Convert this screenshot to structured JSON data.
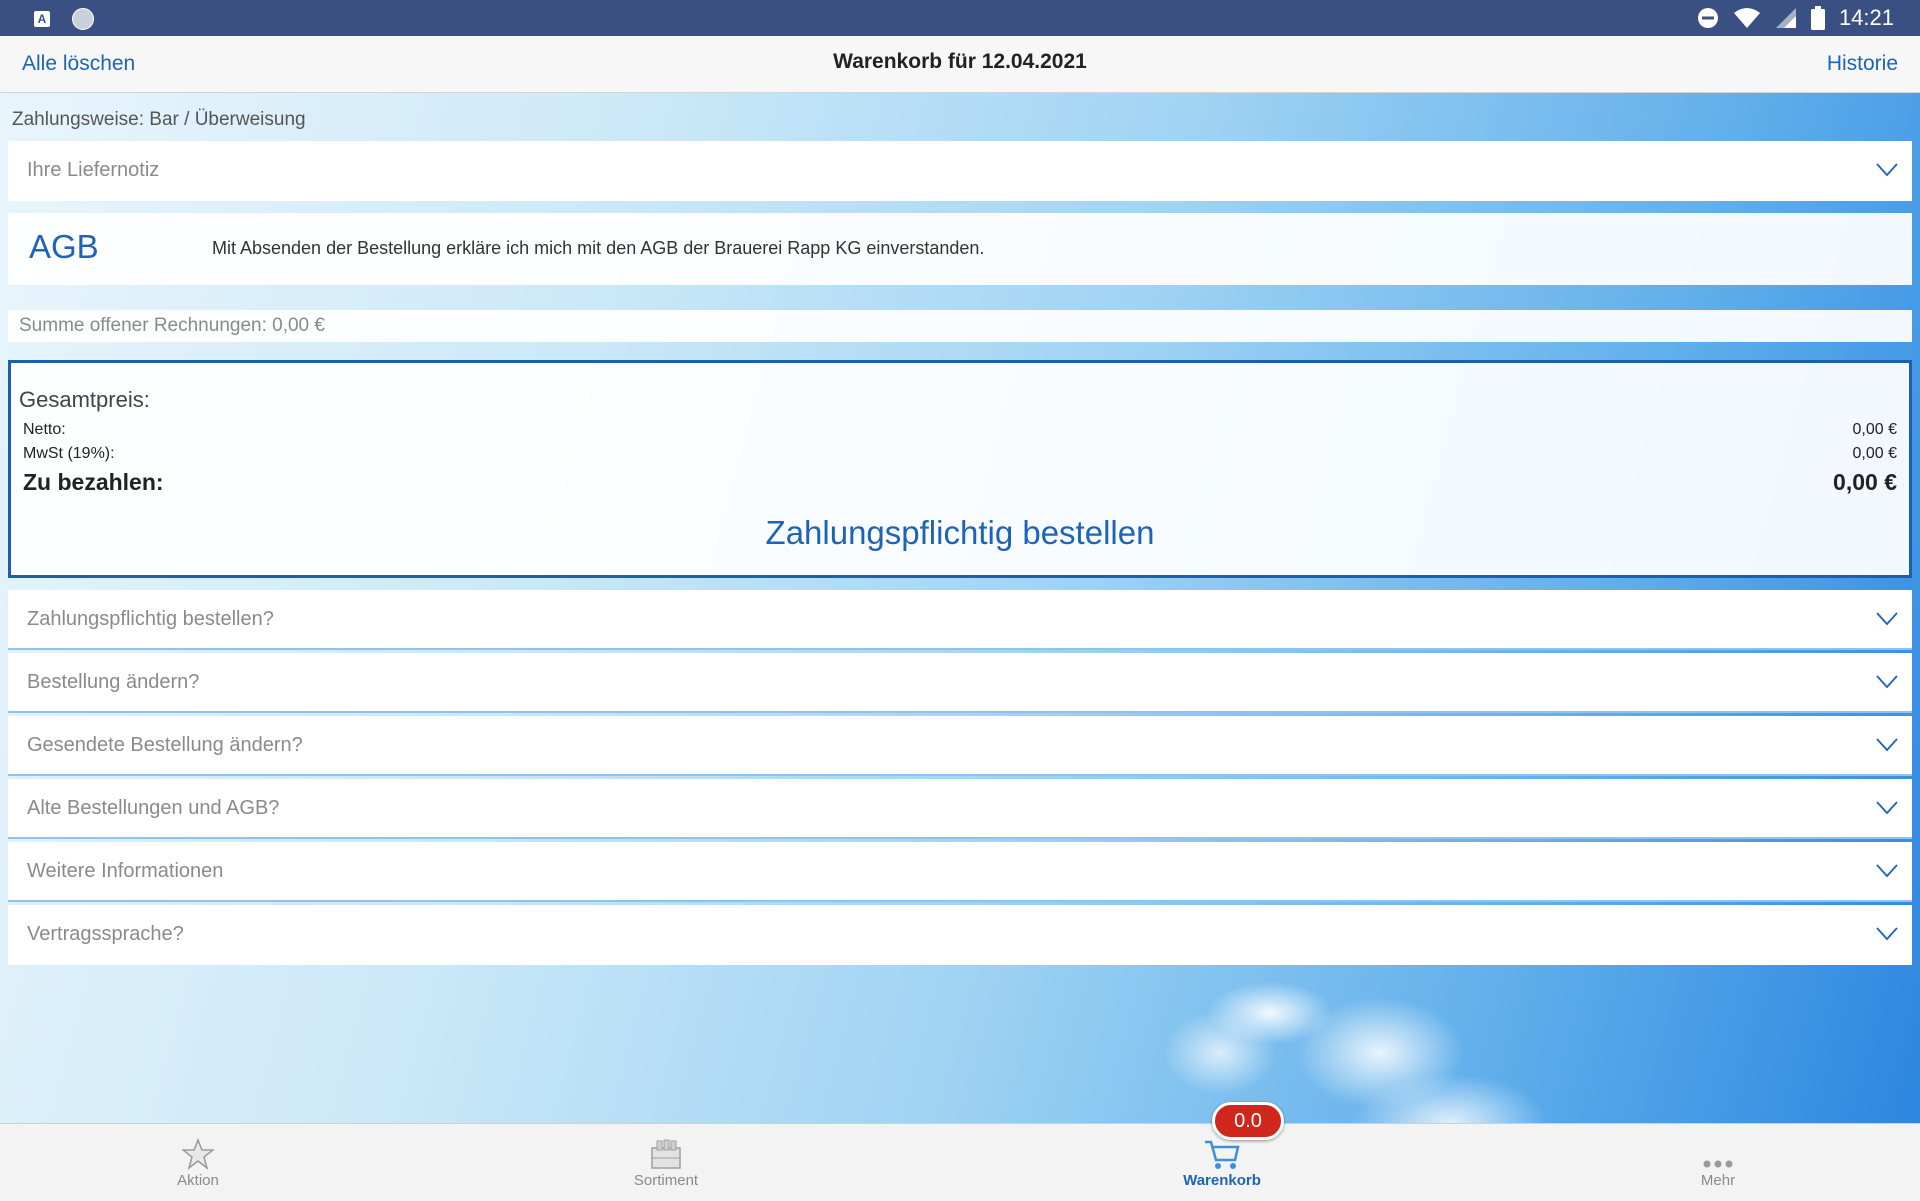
{
  "statusbar": {
    "time": "14:21",
    "left_icons": [
      "app-a-icon",
      "circle-icon"
    ],
    "right_icons": [
      "dnd-icon",
      "wifi-icon",
      "signal-icon",
      "battery-icon"
    ]
  },
  "navbar": {
    "left_label": "Alle löschen",
    "title": "Warenkorb für 12.04.2021",
    "right_label": "Historie"
  },
  "payment": {
    "text": "Zahlungsweise: Bar / Überweisung"
  },
  "delivery_note": {
    "label": "Ihre Liefernotiz"
  },
  "agb": {
    "title": "AGB",
    "text": "Mit Absenden der Bestellung erkläre ich mich mit den AGB der Brauerei Rapp KG einverstanden."
  },
  "invoices": {
    "text": "Summe offener Rechnungen: 0,00 €"
  },
  "totals": {
    "title": "Gesamtpreis:",
    "netto_label": "Netto:",
    "netto_value": "0,00 €",
    "vat_label": "MwSt (19%):",
    "vat_value": "0,00 €",
    "pay_label": "Zu bezahlen:",
    "pay_value": "0,00 €",
    "order_button": "Zahlungspflichtig bestellen"
  },
  "faq": [
    {
      "label": "Zahlungspflichtig bestellen?"
    },
    {
      "label": "Bestellung ändern?"
    },
    {
      "label": "Gesendete Bestellung ändern?"
    },
    {
      "label": "Alte Bestellungen und AGB?"
    },
    {
      "label": "Weitere Informationen"
    },
    {
      "label": "Vertragssprache?"
    }
  ],
  "tabs": [
    {
      "label": "Aktion",
      "icon": "star-icon",
      "active": false
    },
    {
      "label": "Sortiment",
      "icon": "crate-icon",
      "active": false
    },
    {
      "label": "Warenkorb",
      "icon": "cart-icon",
      "active": true
    },
    {
      "label": "Mehr",
      "icon": "more-icon",
      "active": false
    }
  ],
  "cart_badge": "0.0",
  "colors": {
    "accent": "#1d63b8",
    "statusbar": "#3a5083",
    "badge": "#d0261c"
  }
}
